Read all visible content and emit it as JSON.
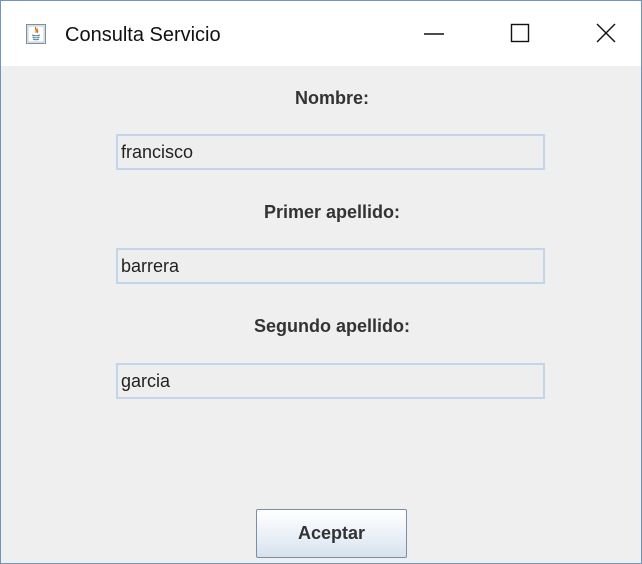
{
  "window": {
    "title": "Consulta Servicio",
    "app_icon": "java-icon",
    "controls": {
      "minimize_icon": "minimize-icon",
      "maximize_icon": "maximize-icon",
      "close_icon": "close-icon"
    }
  },
  "form": {
    "nombre_label": "Nombre:",
    "nombre_value": "francisco",
    "primer_apellido_label": "Primer apellido:",
    "primer_apellido_value": "barrera",
    "segundo_apellido_label": "Segundo apellido:",
    "segundo_apellido_value": "garcia",
    "accept_label": "Aceptar"
  },
  "colors": {
    "window_background": "#efefef",
    "titlebar_background": "#ffffff",
    "field_border": "#c3d5ea",
    "window_border": "#6f95bf"
  }
}
